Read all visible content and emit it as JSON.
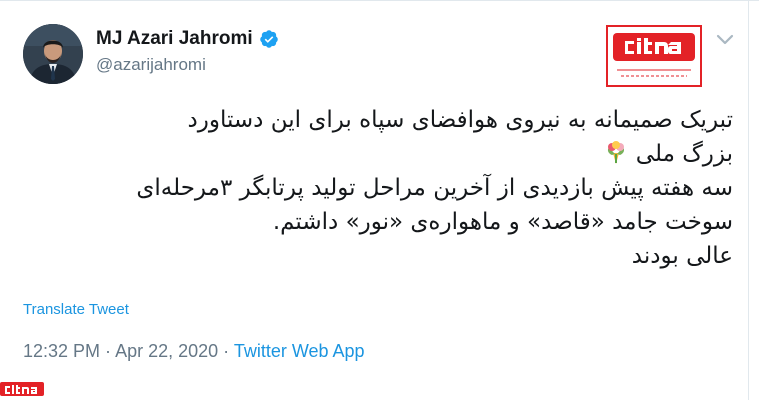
{
  "user": {
    "display_name": "MJ Azari Jahromi",
    "handle": "@azarijahromi"
  },
  "tweet": {
    "lines": [
      "تبریک صمیمانه به نیروی هوافضای سپاه برای این دستاورد",
      "بزرگ ملی",
      "سه هفته پیش بازدیدی از آخرین مراحل تولید پرتابگر ۳مرحله‌ای",
      "سوخت جامد «قاصد» و ماهواره‌ی «نور» داشتم.",
      "عالی بودند"
    ],
    "emoji": "bouquet-icon"
  },
  "actions": {
    "translate_label": "Translate Tweet"
  },
  "meta": {
    "time": "12:32 PM",
    "sep1": " · ",
    "date": "Apr 22, 2020",
    "sep2": " · ",
    "app": "Twitter Web App"
  },
  "watermark": {
    "brand": "citna",
    "site": "www.citna.ir",
    "color": "#e32227"
  },
  "colors": {
    "link": "#1b95e0",
    "muted": "#657786",
    "text": "#14171a",
    "verified": "#1da1f2"
  }
}
